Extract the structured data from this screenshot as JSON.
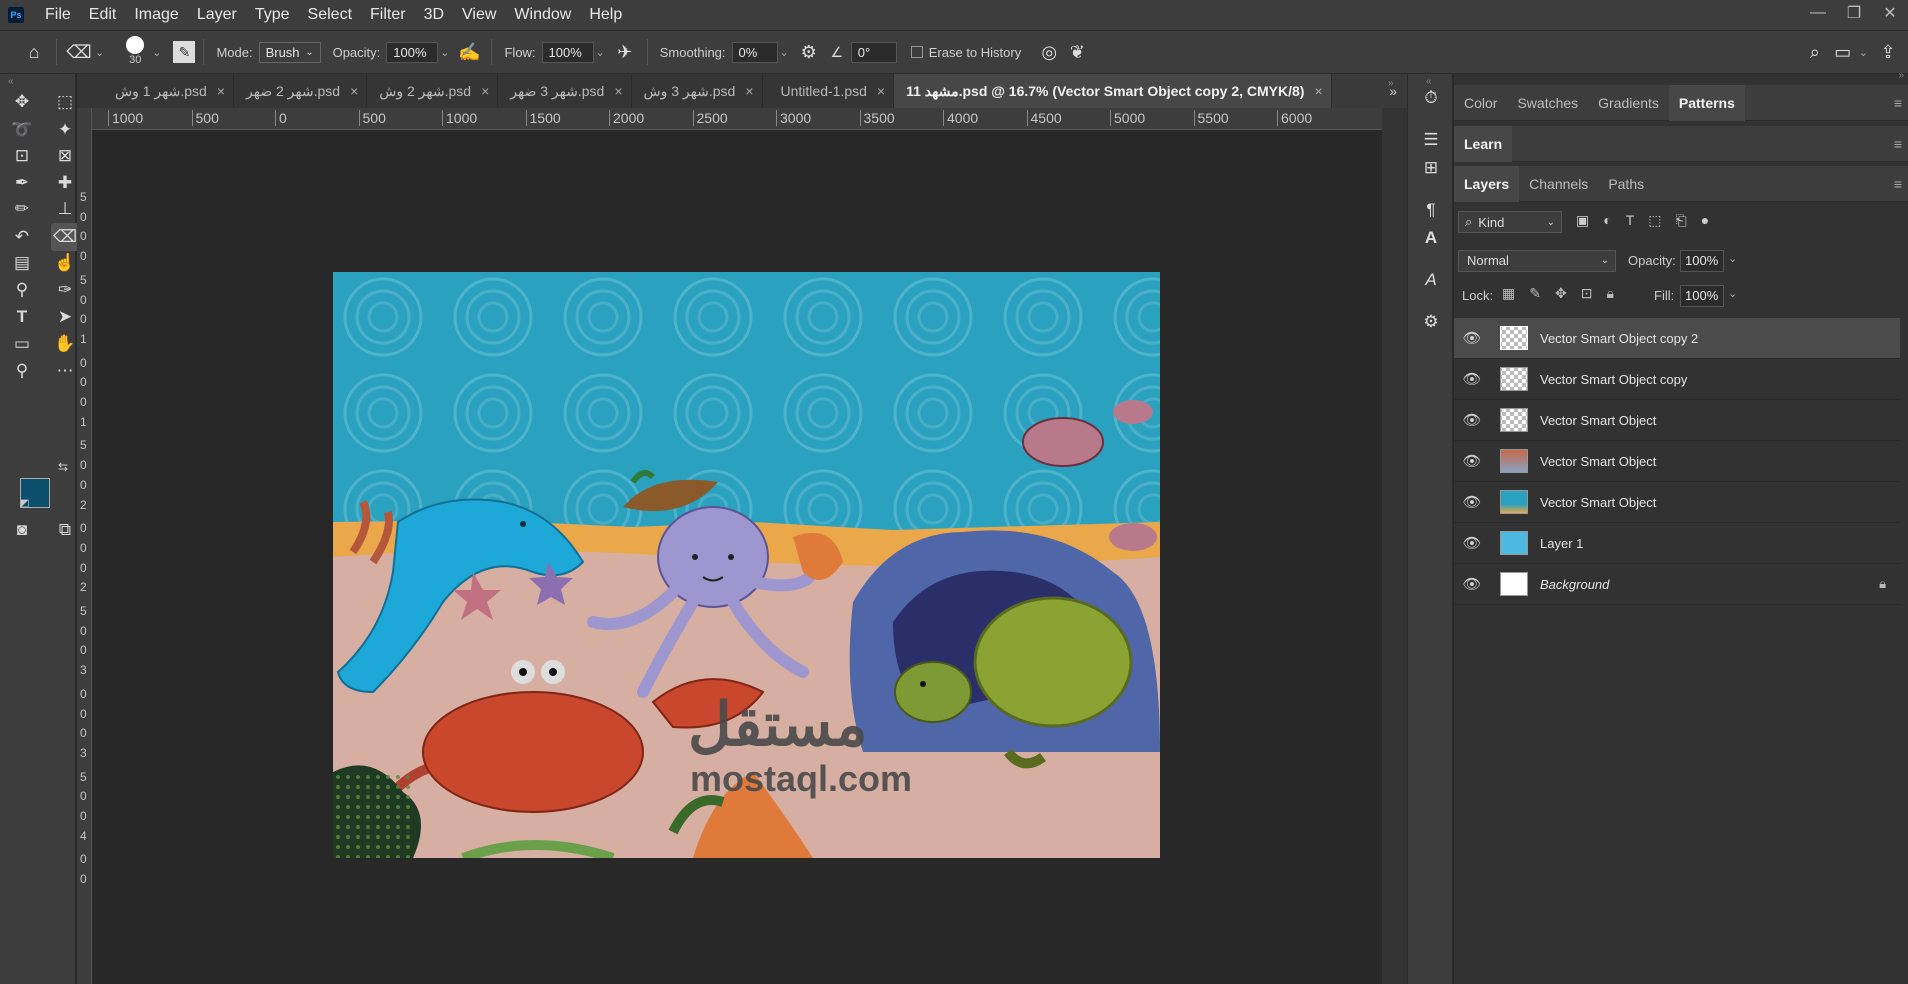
{
  "menubar": {
    "logo": "Ps",
    "items": [
      "File",
      "Edit",
      "Image",
      "Layer",
      "Type",
      "Select",
      "Filter",
      "3D",
      "View",
      "Window",
      "Help"
    ]
  },
  "options": {
    "brush_size": "30",
    "mode_label": "Mode:",
    "mode_value": "Brush",
    "opacity_label": "Opacity:",
    "opacity_value": "100%",
    "flow_label": "Flow:",
    "flow_value": "100%",
    "smoothing_label": "Smoothing:",
    "smoothing_value": "0%",
    "angle_value": "0°",
    "erase_history_label": "Erase to History"
  },
  "tabs": [
    {
      "label": "شهر 1 وش.psd",
      "close": "×"
    },
    {
      "label": "شهر 2 ضهر.psd",
      "close": "×"
    },
    {
      "label": "شهر 2 وش.psd",
      "close": "×"
    },
    {
      "label": "شهر 3 ضهر.psd",
      "close": "×"
    },
    {
      "label": "شهر 3 وش.psd",
      "close": "×"
    },
    {
      "label": "Untitled-1.psd",
      "close": "×"
    },
    {
      "label": "مشهد 11.psd @ 16.7% (Vector Smart Object copy 2, CMYK/8)",
      "close": "×"
    }
  ],
  "ruler": {
    "top_labels": [
      "1000",
      "500",
      "0",
      "500",
      "1000",
      "1500",
      "2000",
      "2500",
      "3000",
      "3500",
      "4000",
      "4500",
      "5000",
      "5500",
      "6000"
    ],
    "left_labels": [
      "5",
      "0",
      "0",
      "0",
      "5",
      "0",
      "0",
      "1",
      "0",
      "0",
      "0",
      "1",
      "5",
      "0",
      "0",
      "2",
      "0",
      "0",
      "0",
      "2",
      "5",
      "0",
      "0",
      "3",
      "0",
      "0",
      "0",
      "3",
      "5",
      "0",
      "0",
      "4",
      "0",
      "0"
    ]
  },
  "colors": {
    "foreground": "#0b4f6c",
    "background": "#f8c838",
    "accent": "#31a8ff"
  },
  "panels": {
    "color_tabs": [
      "Color",
      "Swatches",
      "Gradients",
      "Patterns"
    ],
    "learn_tab": "Learn",
    "layer_tabs": [
      "Layers",
      "Channels",
      "Paths"
    ],
    "filter_kind": "Kind",
    "blend_mode": "Normal",
    "opacity_label": "Opacity:",
    "opacity_value": "100%",
    "lock_label": "Lock:",
    "fill_label": "Fill:",
    "fill_value": "100%"
  },
  "layers": [
    {
      "name": "Vector Smart Object copy 2"
    },
    {
      "name": "Vector Smart Object copy"
    },
    {
      "name": "Vector Smart Object"
    },
    {
      "name": "Vector Smart Object"
    },
    {
      "name": "Vector Smart Object"
    },
    {
      "name": "Layer 1"
    },
    {
      "name": "Background"
    }
  ],
  "watermark": {
    "arabic": "مستقل",
    "latin": "mostaql.com"
  }
}
